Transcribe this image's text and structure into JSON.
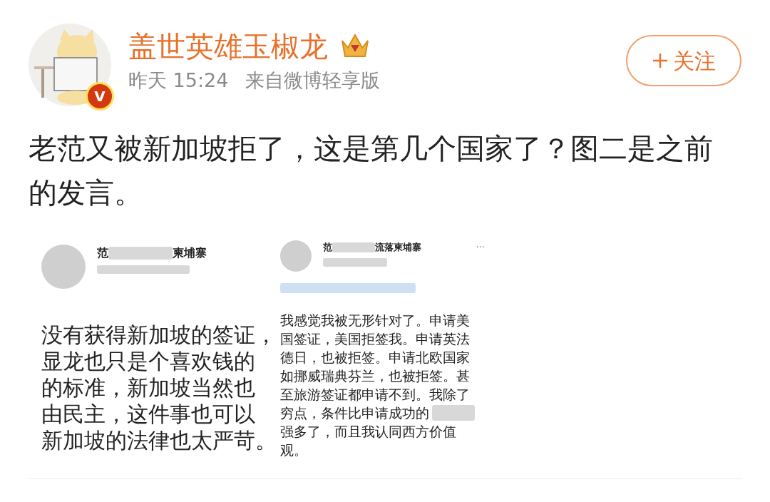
{
  "author": {
    "name": "盖世英雄玉椒龙",
    "verified_mark": "V",
    "time": "昨天 15:24",
    "source": "来自微博轻享版"
  },
  "follow_button": {
    "label": "关注"
  },
  "post_text": "老范又被新加坡拒了，这是第几个国家了？图二是之前的发言。",
  "images": [
    {
      "kind": "large",
      "name_start": "范",
      "name_end": "柬埔寨",
      "lines": [
        {
          "text": "没有获得新加坡的签证，",
          "redacted_tail": false
        },
        {
          "text": "显龙也只是个喜欢钱的",
          "redacted_tail": false
        },
        {
          "text": "的标准，新加坡当然也",
          "redacted_tail": false
        },
        {
          "text": "由民主，这件事也可以",
          "redacted_tail": false
        },
        {
          "text": "新加坡的法律也太严苛。",
          "redacted_tail": false
        }
      ]
    },
    {
      "kind": "compact",
      "name_start": "范",
      "name_end": "流落柬埔寨",
      "menu": "···",
      "lines": [
        {
          "text": "我感觉我被无形针对了。申请美",
          "redacted_tail": false
        },
        {
          "text": "国签证，美国拒签我。申请英法",
          "redacted_tail": false
        },
        {
          "text": "德日，也被拒签。申请北欧国家",
          "redacted_tail": false
        },
        {
          "text": "如挪威瑞典芬兰，也被拒签。甚",
          "redacted_tail": false
        },
        {
          "text": "至旅游签证都申请不到。我除了",
          "redacted_tail": false
        },
        {
          "text": "穷点，条件比申请成功的",
          "redacted_tail": true
        },
        {
          "text": "强多了，而且我认同西方价值",
          "redacted_tail": false
        },
        {
          "text": "观。",
          "redacted_tail": false
        }
      ]
    }
  ]
}
